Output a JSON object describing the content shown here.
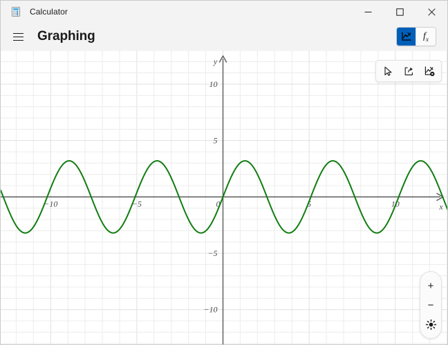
{
  "window": {
    "app_icon": "calculator-icon",
    "title": "Calculator",
    "minimize_label": "─",
    "maximize_label": "□",
    "close_label": "✕"
  },
  "commandbar": {
    "menu_icon": "hamburger-menu-icon",
    "page_title": "Graphing",
    "mode_toggle": {
      "graph_label": "graph-mode-icon",
      "graph_selected": true,
      "function_label": "f",
      "function_sub": "x",
      "function_selected": false
    }
  },
  "graph_tools": {
    "items": [
      {
        "name": "pointer-tool",
        "icon": "cursor-arrow-icon"
      },
      {
        "name": "share-tool",
        "icon": "share-icon"
      },
      {
        "name": "graph-settings-tool",
        "icon": "graph-settings-icon"
      }
    ]
  },
  "zoom_controls": {
    "zoom_in_label": "+",
    "zoom_out_label": "−",
    "reset_view_label": "reset-view-icon"
  },
  "colors": {
    "accent": "#005fb8",
    "curve": "#107c10",
    "axis": "#5a5a5a",
    "grid_minor": "#ececec",
    "grid_major": "#e0e0e0",
    "window_bg": "#f3f3f3",
    "graph_bg": "#ffffff"
  },
  "chart_data": {
    "type": "line",
    "title": "",
    "xlabel": "x",
    "ylabel": "y",
    "xlim": [
      -12.9,
      13.1
    ],
    "ylim": [
      -13.2,
      13.0
    ],
    "xticks": [
      -10,
      -5,
      0,
      5,
      10
    ],
    "xticklabels": [
      "−10",
      "−5",
      "0",
      "5",
      "10"
    ],
    "yticks": [
      -10,
      -5,
      5,
      10
    ],
    "yticklabels": [
      "−10",
      "−5",
      "5",
      "10"
    ],
    "grid": true,
    "grid_step": 1,
    "legend": "none",
    "axis_arrows": true,
    "series": [
      {
        "name": "sine",
        "color": "#107c10",
        "expression": "y = 3.2 sin(1.23 x)",
        "amplitude": 3.2,
        "period": 5.1,
        "phase": 0,
        "samples_x": [
          -12.9,
          -12.4,
          -11.9,
          -11.4,
          -10.9,
          -10.4,
          -9.9,
          -9.4,
          -8.9,
          -8.4,
          -7.9,
          -7.4,
          -6.9,
          -6.4,
          -5.9,
          -5.4,
          -4.9,
          -4.4,
          -3.9,
          -3.4,
          -2.9,
          -2.4,
          -1.9,
          -1.4,
          -0.9,
          -0.4,
          0,
          0.4,
          0.9,
          1.4,
          1.9,
          2.4,
          2.9,
          3.4,
          3.9,
          4.4,
          4.9,
          5.4,
          5.9,
          6.4,
          6.9,
          7.4,
          7.9,
          8.4,
          8.9,
          9.4,
          9.9,
          10.4,
          10.9,
          11.4,
          11.9,
          12.4,
          13.1
        ]
      }
    ]
  }
}
